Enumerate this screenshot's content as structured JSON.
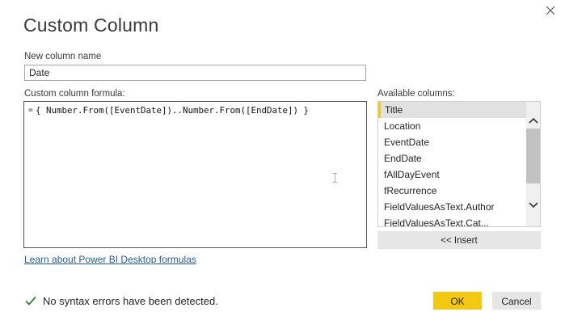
{
  "dialog": {
    "title": "Custom Column"
  },
  "name_field": {
    "label": "New column name",
    "value": "Date"
  },
  "formula": {
    "label": "Custom column formula:",
    "prefix": "=",
    "value": "{ Number.From([EventDate])..Number.From([EndDate]) }"
  },
  "available_columns": {
    "label": "Available columns:",
    "items": [
      "Title",
      "Location",
      "EventDate",
      "EndDate",
      "fAllDayEvent",
      "fRecurrence",
      "FieldValuesAsText.Author",
      "FieldValuesAsText.Cat..."
    ],
    "selected": "Title"
  },
  "insert_button": {
    "label": "<< Insert"
  },
  "learn_link": {
    "label": "Learn about Power BI Desktop formulas"
  },
  "status": {
    "text": "No syntax errors have been detected.",
    "icon": "checkmark-icon",
    "color": "#2e7d32"
  },
  "buttons": {
    "ok": "OK",
    "cancel": "Cancel"
  },
  "colors": {
    "accent": "#f2c811",
    "link": "#1f5c99"
  }
}
